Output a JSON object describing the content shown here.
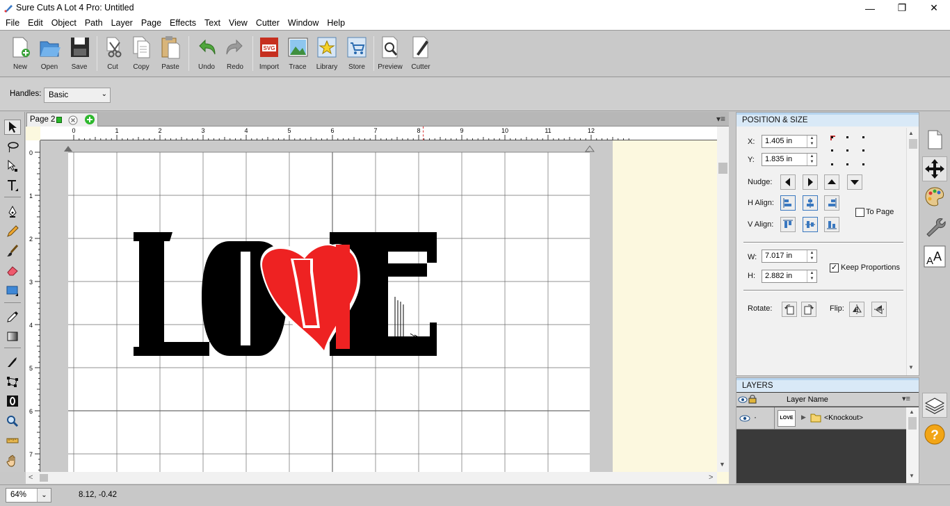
{
  "window": {
    "title": "Sure Cuts A Lot 4 Pro: Untitled",
    "minimize": "—",
    "maximize": "❐",
    "close": "✕"
  },
  "menu": [
    "File",
    "Edit",
    "Object",
    "Path",
    "Layer",
    "Page",
    "Effects",
    "Text",
    "View",
    "Cutter",
    "Window",
    "Help"
  ],
  "toolbar": {
    "new": "New",
    "open": "Open",
    "save": "Save",
    "cut": "Cut",
    "copy": "Copy",
    "paste": "Paste",
    "undo": "Undo",
    "redo": "Redo",
    "import": "Import",
    "trace": "Trace",
    "library": "Library",
    "store": "Store",
    "preview": "Preview",
    "cutter": "Cutter"
  },
  "handles": {
    "label": "Handles:",
    "value": "Basic"
  },
  "page_tab": {
    "label": "Page 2"
  },
  "ruler": {
    "top": [
      "0",
      "1",
      "2",
      "3",
      "4",
      "5",
      "6",
      "7",
      "8",
      "9",
      "10",
      "11",
      "12"
    ],
    "left": [
      "0",
      "1",
      "2",
      "3",
      "4",
      "5",
      "6",
      "7"
    ]
  },
  "artwork": {
    "text": "LOVE",
    "primary_color": "#000000",
    "heart_color": "#ee2222"
  },
  "position_size": {
    "title": "POSITION & SIZE",
    "x_label": "X:",
    "x_value": "1.405 in",
    "y_label": "Y:",
    "y_value": "1.835 in",
    "nudge_label": "Nudge:",
    "halign_label": "H Align:",
    "valign_label": "V Align:",
    "to_page_label": "To Page",
    "w_label": "W:",
    "w_value": "7.017 in",
    "h_label": "H:",
    "h_value": "2.882 in",
    "keep_proportions_label": "Keep Proportions",
    "keep_proportions_checked": "✓",
    "rotate_label": "Rotate:",
    "flip_label": "Flip:"
  },
  "layers": {
    "title": "LAYERS",
    "column": "Layer Name",
    "row": {
      "name": "<Knockout>",
      "dot": "·"
    }
  },
  "status": {
    "zoom": "64%",
    "coords": "8.12, -0.42"
  }
}
